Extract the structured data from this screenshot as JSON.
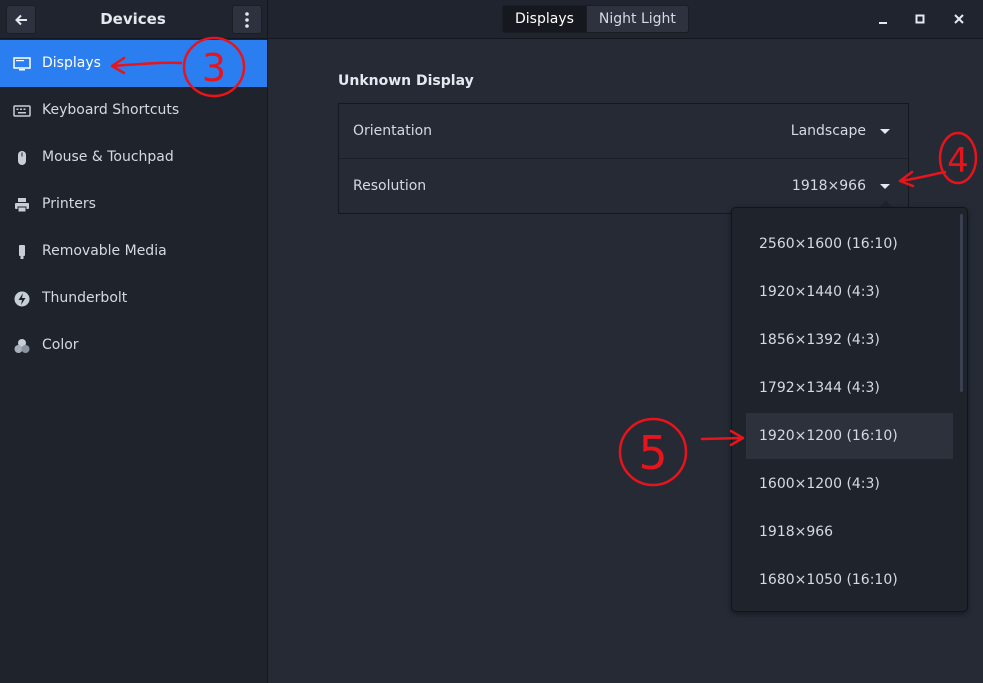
{
  "header": {
    "title": "Devices",
    "tabs": [
      {
        "label": "Displays",
        "active": true
      },
      {
        "label": "Night Light",
        "active": false
      }
    ]
  },
  "sidebar": {
    "items": [
      {
        "label": "Displays",
        "icon": "display-icon",
        "selected": true
      },
      {
        "label": "Keyboard Shortcuts",
        "icon": "keyboard-icon",
        "selected": false
      },
      {
        "label": "Mouse & Touchpad",
        "icon": "mouse-icon",
        "selected": false
      },
      {
        "label": "Printers",
        "icon": "printer-icon",
        "selected": false
      },
      {
        "label": "Removable Media",
        "icon": "usb-drive-icon",
        "selected": false
      },
      {
        "label": "Thunderbolt",
        "icon": "thunderbolt-icon",
        "selected": false
      },
      {
        "label": "Color",
        "icon": "color-icon",
        "selected": false
      }
    ]
  },
  "main": {
    "section_title": "Unknown Display",
    "orientation": {
      "label": "Orientation",
      "value": "Landscape"
    },
    "resolution": {
      "label": "Resolution",
      "value": "1918×966"
    }
  },
  "resolution_options": [
    "2560×1600 (16:10)",
    "1920×1440 (4:3)",
    "1856×1392 (4:3)",
    "1792×1344 (4:3)",
    "1920×1200 (16:10)",
    "1600×1200 (4:3)",
    "1918×966",
    "1680×1050 (16:10)"
  ],
  "hovered_option": "1920×1200 (16:10)",
  "annotations": {
    "step3": "3",
    "step4": "4",
    "step5": "5",
    "color": "#e8141c"
  },
  "colors": {
    "accent": "#2b7ef0",
    "background": "#252a35",
    "sidebar": "#1f232c"
  }
}
